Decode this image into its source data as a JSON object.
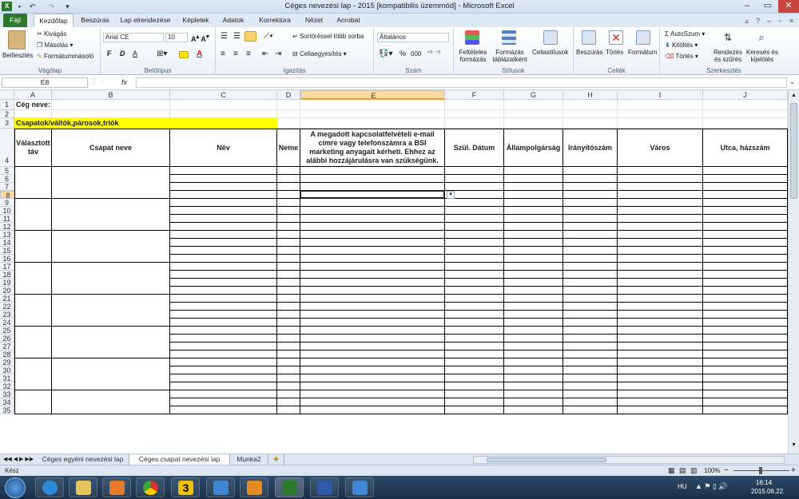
{
  "window": {
    "title": "Céges nevezési lap - 2015  [kompatibilis üzemmód]  -  Microsoft Excel",
    "min": "–",
    "max": "▭",
    "close": "✕"
  },
  "tabs": [
    "Fájl",
    "Kezdőlap",
    "Beszúrás",
    "Lap elrendezése",
    "Képletek",
    "Adatok",
    "Korrektúra",
    "Nézet",
    "Acrobat"
  ],
  "ribbon": {
    "clipboard": {
      "label": "Vágólap",
      "paste": "Beillesztés",
      "cut": "Kivágás",
      "copy": "Másolás",
      "format_painter": "Formátummásoló"
    },
    "font": {
      "label": "Betűtípus",
      "name": "Arial CE",
      "size": "10",
      "bold": "F",
      "italic": "D",
      "underline": "A"
    },
    "alignment": {
      "label": "Igazítás",
      "wrap": "Sortöréssel több sorba",
      "merge": "Cellaegyesítés"
    },
    "number": {
      "label": "Szám",
      "format": "Általános",
      "percent": "%",
      "thousands": "000"
    },
    "styles": {
      "label": "Stílusok",
      "conditional": "Feltételes formázás",
      "table": "Formázás táblázatként",
      "cell_styles": "Cellastílusok"
    },
    "cells": {
      "label": "Cellák",
      "insert": "Beszúrás",
      "delete": "Törlés",
      "format": "Formátum"
    },
    "editing": {
      "label": "Szerkesztés",
      "autosum": "AutoSzum",
      "fill": "Kitöltés",
      "clear": "Törlés",
      "sort": "Rendezés és szűrés",
      "find": "Keresés és kijelölés"
    }
  },
  "formula_bar": {
    "name_box": "E8",
    "fx": "fx",
    "value": ""
  },
  "columns": [
    "A",
    "B",
    "C",
    "D",
    "E",
    "F",
    "G",
    "H",
    "I",
    "J"
  ],
  "selected_column": "E",
  "selected_row": "8",
  "rows": [
    "1",
    "2",
    "3",
    "4",
    "5",
    "6",
    "7",
    "8",
    "9",
    "10",
    "11",
    "12",
    "13",
    "14",
    "15",
    "16",
    "17",
    "18",
    "19",
    "20",
    "21",
    "22",
    "23",
    "24",
    "25",
    "26",
    "27",
    "28",
    "29",
    "30",
    "31",
    "32",
    "33",
    "34",
    "35"
  ],
  "cells": {
    "a1": "Cég neve:",
    "a3": "Csapatok/váltók,párosok,triók",
    "headers": [
      "Választott táv",
      "Csapat neve",
      "Név",
      "Neme",
      "A megadott kapcsolatfelvételi e-mail címre vagy telefonszámra a BSI marketing anyagait kérheti. Ehhez az alábbi hozzájárulásra van szükségünk.",
      "Szül. Dátum",
      "Állampolgárság",
      "Irányítószám",
      "Város",
      "Utca, házszám"
    ]
  },
  "sheets": [
    "Céges egyéni nevezési lap",
    "Céges csapat nevezési  lap",
    "Munka2"
  ],
  "active_sheet": 1,
  "status": {
    "mode": "Kész",
    "zoom": "100%",
    "minus": "−",
    "plus": "+"
  },
  "taskbar": {
    "lang": "HU",
    "time": "16:14",
    "date": "2015.06.22.",
    "badge": "3"
  },
  "colors": {
    "highlight": "#ffff00",
    "excel_green": "#2b7a2b",
    "taskbar": "#1f3a5a"
  }
}
